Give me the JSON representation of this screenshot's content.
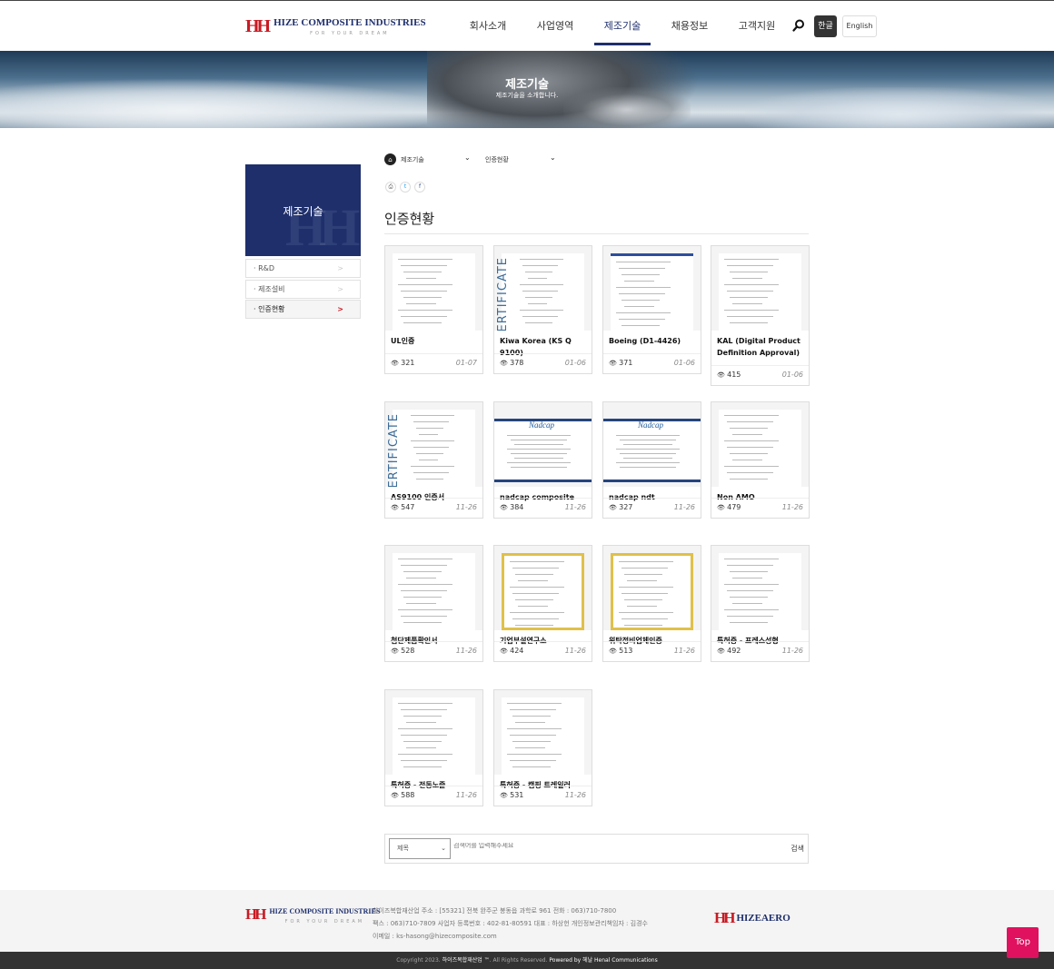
{
  "header": {
    "logo_name": "HIZE COMPOSITE INDUSTRIES",
    "logo_slogan": "FOR YOUR DREAM",
    "nav": [
      "회사소개",
      "사업영역",
      "제조기술",
      "채용정보",
      "고객지원"
    ],
    "active_nav": "제조기술",
    "lang_ko": "한글",
    "lang_en": "English"
  },
  "hero": {
    "title": "제조기술",
    "subtitle": "제조기술을 소개합니다."
  },
  "sidebar": {
    "title": "제조기술",
    "items": [
      {
        "label": "R&D"
      },
      {
        "label": "제조설비"
      },
      {
        "label": "인증현황"
      }
    ]
  },
  "location": {
    "level1": "제조기술",
    "level2": "인증현황"
  },
  "page_title": "인증현황",
  "cards": [
    {
      "title": "UL인증",
      "views": "321",
      "date": "01-07"
    },
    {
      "title": "Kiwa Korea (KS Q 9100)",
      "views": "378",
      "date": "01-06"
    },
    {
      "title": "Boeing (D1-4426)",
      "views": "371",
      "date": "01-06"
    },
    {
      "title": "KAL (Digital Product Definition Approval)",
      "views": "415",
      "date": "01-06"
    },
    {
      "title": "AS9100 인증서",
      "views": "547",
      "date": "11-26"
    },
    {
      "title": "nadcap composite",
      "views": "384",
      "date": "11-26"
    },
    {
      "title": "nadcap ndt",
      "views": "327",
      "date": "11-26"
    },
    {
      "title": "Non AMO",
      "views": "479",
      "date": "11-26"
    },
    {
      "title": "첨단제품확인서",
      "views": "528",
      "date": "11-26"
    },
    {
      "title": "기업부설연구소",
      "views": "424",
      "date": "11-26"
    },
    {
      "title": "위탁정비업체인증",
      "views": "513",
      "date": "11-26"
    },
    {
      "title": "특허증 - 프레스성형",
      "views": "492",
      "date": "11-26"
    },
    {
      "title": "특허증 - 전동노즐",
      "views": "588",
      "date": "11-26"
    },
    {
      "title": "특허증 - 캠핑 트레일러",
      "views": "531",
      "date": "11-26"
    }
  ],
  "search": {
    "select_value": "제목",
    "placeholder": "검색어를 입력해주세요",
    "submit": "검색"
  },
  "footer": {
    "line1": "하이즈복합재산업    주소 : [55321] 전북 완주군 봉동읍 과학로 961    전화 : 063)710-7800",
    "line2": "팩스 : 063)710-7809    사업자 등록번호 : 402-81-80591    대표 : 하상헌    개인정보관리책임자 : 김경수",
    "line3": "이메일 : ks-hasong@hizecomposite.com",
    "logo2": "HIZEAERO",
    "copyright_pre": "Copyright 2023. ",
    "copyright_company": "하이즈복합재산업 ™",
    "copyright_mid": ". All Rights Reserved. ",
    "copyright_powered": "Powered by 헤날 Henal Communications"
  },
  "top_button": "Top",
  "icons": {
    "search": "search-icon",
    "home": "home-icon",
    "print": "print-icon",
    "twitter": "twitter-icon",
    "facebook": "facebook-icon",
    "eye": "eye-icon"
  },
  "colors": {
    "brand_navy": "#1e2f6c",
    "brand_red": "#c81b24",
    "top_button": "#e0115f"
  }
}
